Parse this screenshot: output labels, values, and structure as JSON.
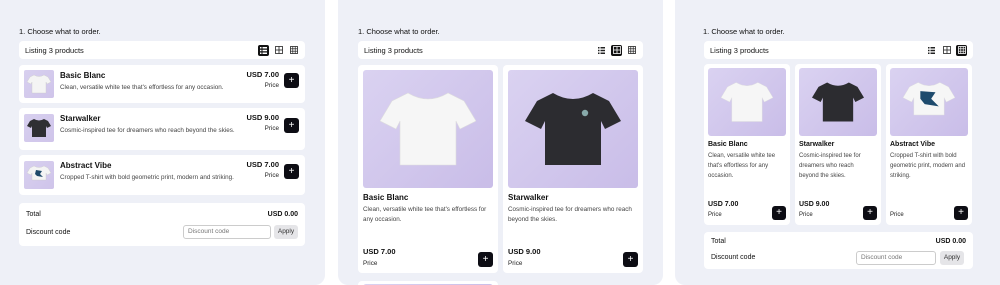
{
  "heading": "1.  Choose what to order.",
  "listing": "Listing 3 products",
  "views": [
    "list-view-icon",
    "grid-view-icon",
    "compact-grid-icon"
  ],
  "products": [
    {
      "name": "Basic Blanc",
      "desc": "Clean, versatile white tee that's effortless for any occasion.",
      "price": "USD 7.00",
      "color": "white"
    },
    {
      "name": "Starwalker",
      "desc": "Cosmic-inspired tee for dreamers who reach beyond the skies.",
      "price": "USD 9.00",
      "color": "black"
    },
    {
      "name": "Abstract Vibe",
      "desc": "Cropped T-shirt with bold geometric print, modern and striking.",
      "price": "USD 7.00",
      "color": "white-print"
    }
  ],
  "price_label": "Price",
  "add_label": "+",
  "summary": {
    "total_label": "Total",
    "total_value": "USD 0.00",
    "discount_label": "Discount code",
    "discount_placeholder": "Discount code",
    "apply_label": "Apply"
  },
  "colors": {
    "accent": "#0d0d14",
    "panel": "#eef0f7",
    "image_bg": "#d4caee"
  }
}
